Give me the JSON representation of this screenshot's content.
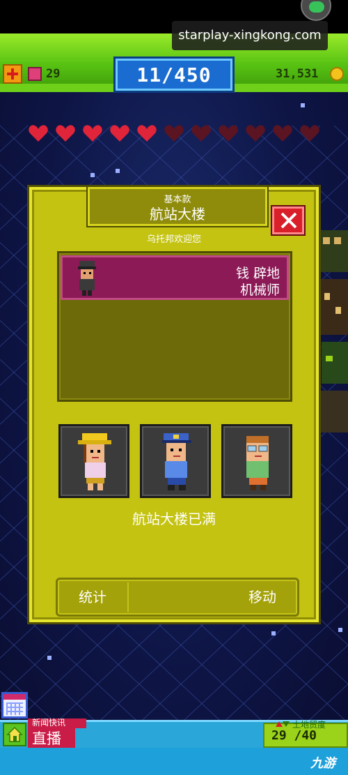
{
  "hud": {
    "bux": "29",
    "population": "11/450",
    "coins": "31,531"
  },
  "watermark": "starplay-xingkong.com",
  "hearts": {
    "filled": 5,
    "total": 11,
    "filled_color": "#e0243a",
    "empty_color": "#5a1422"
  },
  "dialog": {
    "subtitle": "基本款",
    "building_name": "航站大楼",
    "welcome": "乌托邦欢迎您",
    "resident": {
      "name": "钱 辟地",
      "job": "机械师"
    },
    "full_text": "航站大楼已满",
    "stats_label": "统计",
    "move_label": "移动"
  },
  "slots": [
    {
      "name": "worker-hardhat",
      "hat": "#f0c81e",
      "shirt": "#f0d0e8",
      "hair": "#7a3a10",
      "pants": "#d0a020"
    },
    {
      "name": "worker-police",
      "hat": "#3a62c8",
      "shirt": "#5a8ae8",
      "hair": "#202020",
      "pants": "#2a4aa8"
    },
    {
      "name": "worker-goggles",
      "hat": "#c07028",
      "shirt": "#70c070",
      "hair": "#c07028",
      "pants": "#e07030"
    }
  ],
  "bottom": {
    "news_label": "新闻快讯",
    "live_label": "直播",
    "floors_label": "土地贸度",
    "floors": "29 /40",
    "logo": "九游"
  }
}
